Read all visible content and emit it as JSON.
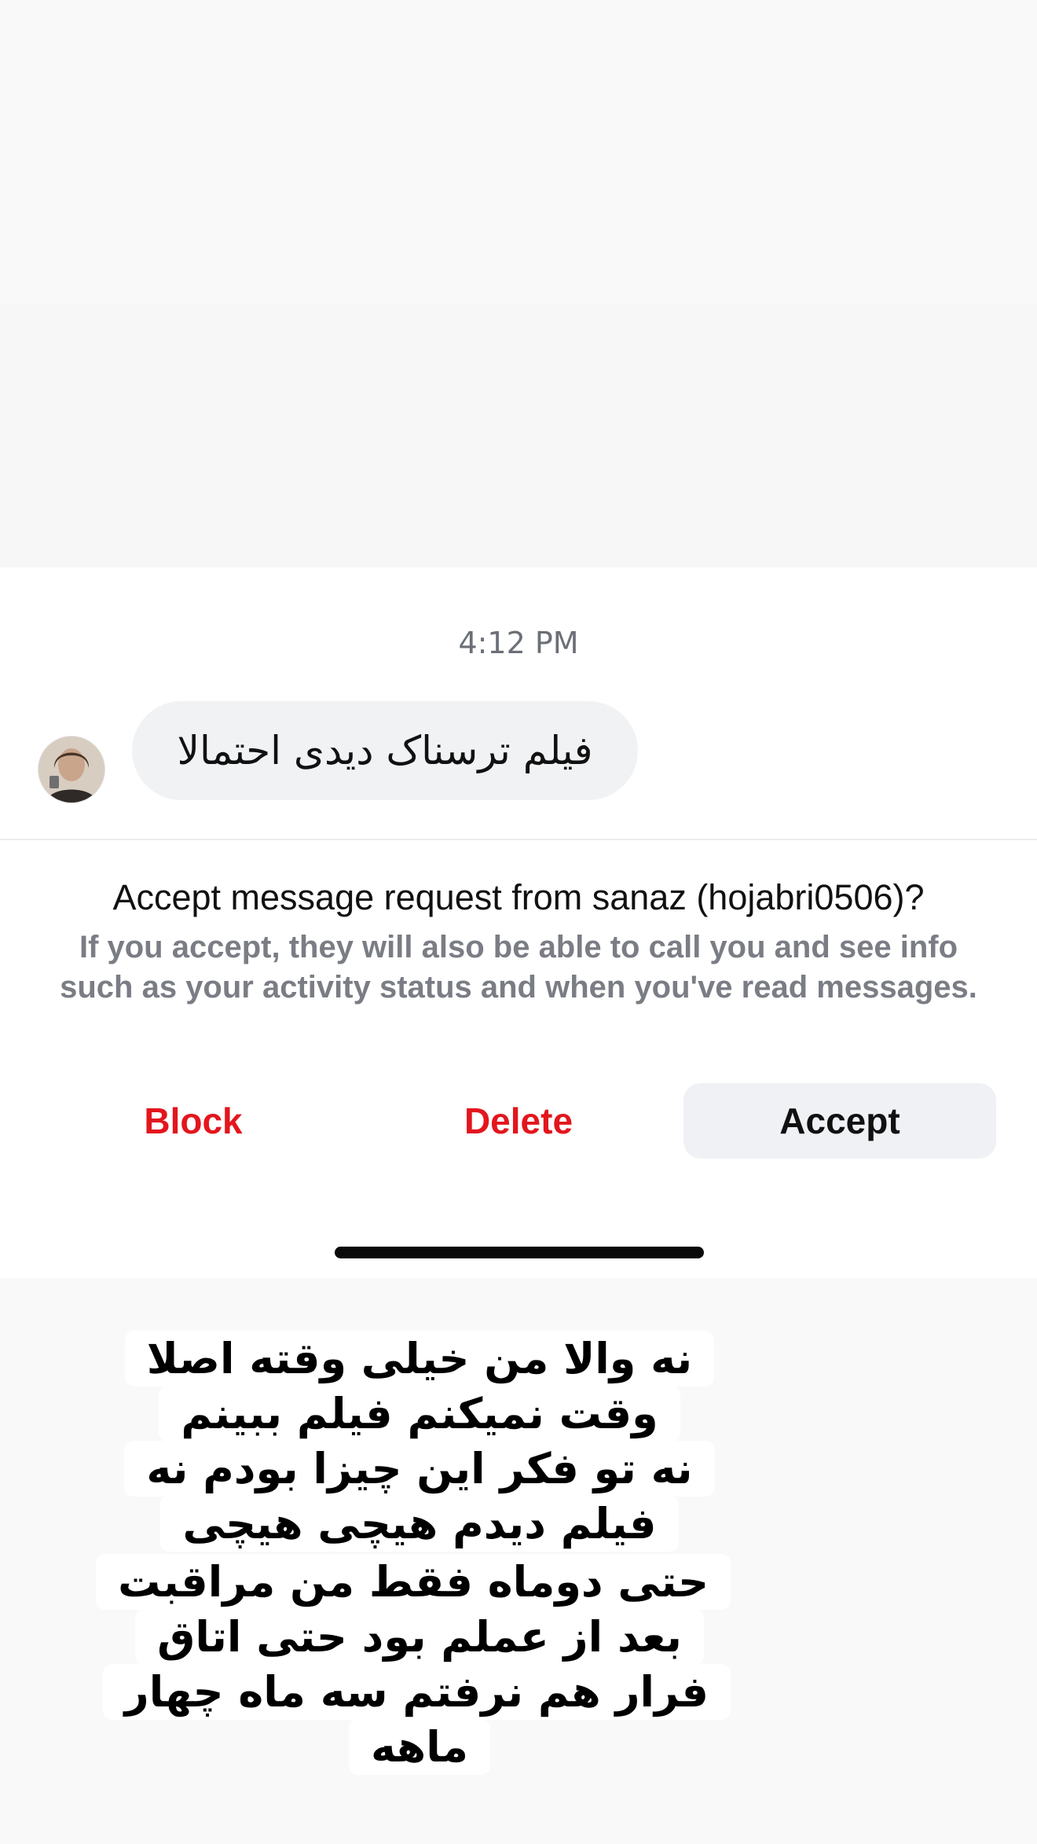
{
  "chat": {
    "timestamp": "4:12 PM",
    "message": "فیلم ترسناک دیدی احتمالا"
  },
  "request": {
    "title": "Accept message request from sanaz (hojabri0506)?",
    "description": "If you accept, they will also be able to call you and see info such as your activity status and when you've read messages."
  },
  "actions": {
    "block": "Block",
    "delete": "Delete",
    "accept": "Accept"
  },
  "colors": {
    "danger": "#e3161d",
    "bubble": "#f1f2f4",
    "accept_bg": "#eff1f4"
  },
  "caption": {
    "line1": "نه والا من خیلی وقته اصلا وقت نمیکنم فیلم ببینم",
    "line2": "نه تو فکر این چیزا بودم نه فیلم دیدم هیچی هیچی",
    "line3": "حتی دوماه فقط من مراقبت بعد از عملم بود حتی اتاق فرار هم نرفتم سه ماه چهار ماهه"
  }
}
